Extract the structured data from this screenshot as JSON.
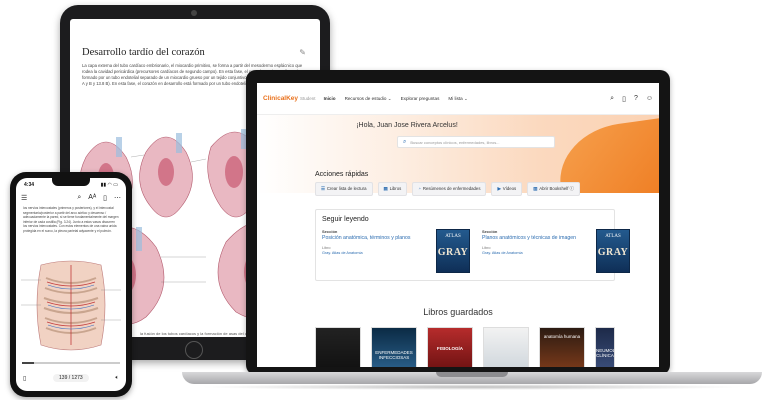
{
  "tablet": {
    "title": "Desarrollo tardío del corazón",
    "body": "La capa externa del tubo cardíaco embrionario, el miocardio primitivo, se forma a partir del mesodermo esplácnico que rodea la cavidad pericárdica (precursores cardíacos de segundo campo). En esta fase, el corazón en desarrollo está formado por un tubo endotelial separado de un miocardio grueso por un tejido conjuntivo gelatinoso denominado Fig. 13.8 A y B y 13.8 B). En esta fase, el corazón en desarrollo está formado por un tubo endotelial (Fig. 13.8 C y D).",
    "caption": "la fusión de los tubos cardíacos y la formación de asas del corazón"
  },
  "laptop": {
    "logo": "ClinicalKey",
    "logo_sub": "Student",
    "nav": [
      "Inicio",
      "Recursos de estudio ⌄",
      "Explorar preguntas",
      "Mi lista ⌄"
    ],
    "greeting": "¡Hola, Juan Jose Rivera Arcelus!",
    "search_placeholder": "Buscar conceptos clínicos, enfermedades, libros...",
    "quick_actions_title": "Acciones rápidas",
    "quick_actions": [
      "Crear lista de lectura",
      "Libros",
      "Resúmenes de enfermedades",
      "Vídeos",
      "Abrir Bookshelf ⓘ"
    ],
    "continue_reading_title": "Seguir leyendo",
    "reading_items": [
      {
        "section_label": "Sección",
        "section": "Posición anatómica, términos y planos",
        "book_label": "Libro",
        "book": "Gray. Atlas de Anatomía"
      },
      {
        "section_label": "Sección",
        "section": "Planos anatómicos y técnicas de imagen",
        "book_label": "Libro",
        "book": "Gray. Atlas de Anatomía"
      }
    ],
    "cover_text": [
      "ATLAS",
      "GRAY"
    ],
    "saved_books_title": "Libros guardados",
    "saved_books": [
      "ENFERMEDADES INFECCIOSAS",
      "FISIOLOGÍA",
      "",
      "anatomía humana",
      "NEUMOLOGÍA CLÍNICA"
    ]
  },
  "phone": {
    "time": "4:34",
    "page": "139 / 1273",
    "text": "los nervios intercostales (primeros y posteriores), y el intercostal segmentario/posterior a partir del arco aórtico y descenso / adecuadamente la pared, si se tiene fundamentalmente del margen inferior de cada costilla (Fig. 3.24). Junto a estos vasos discurren los nervios intercostales. Con estos elementos de una vaina unida protegida en el surco, la pleura parietal adyacente y el pulmón."
  }
}
